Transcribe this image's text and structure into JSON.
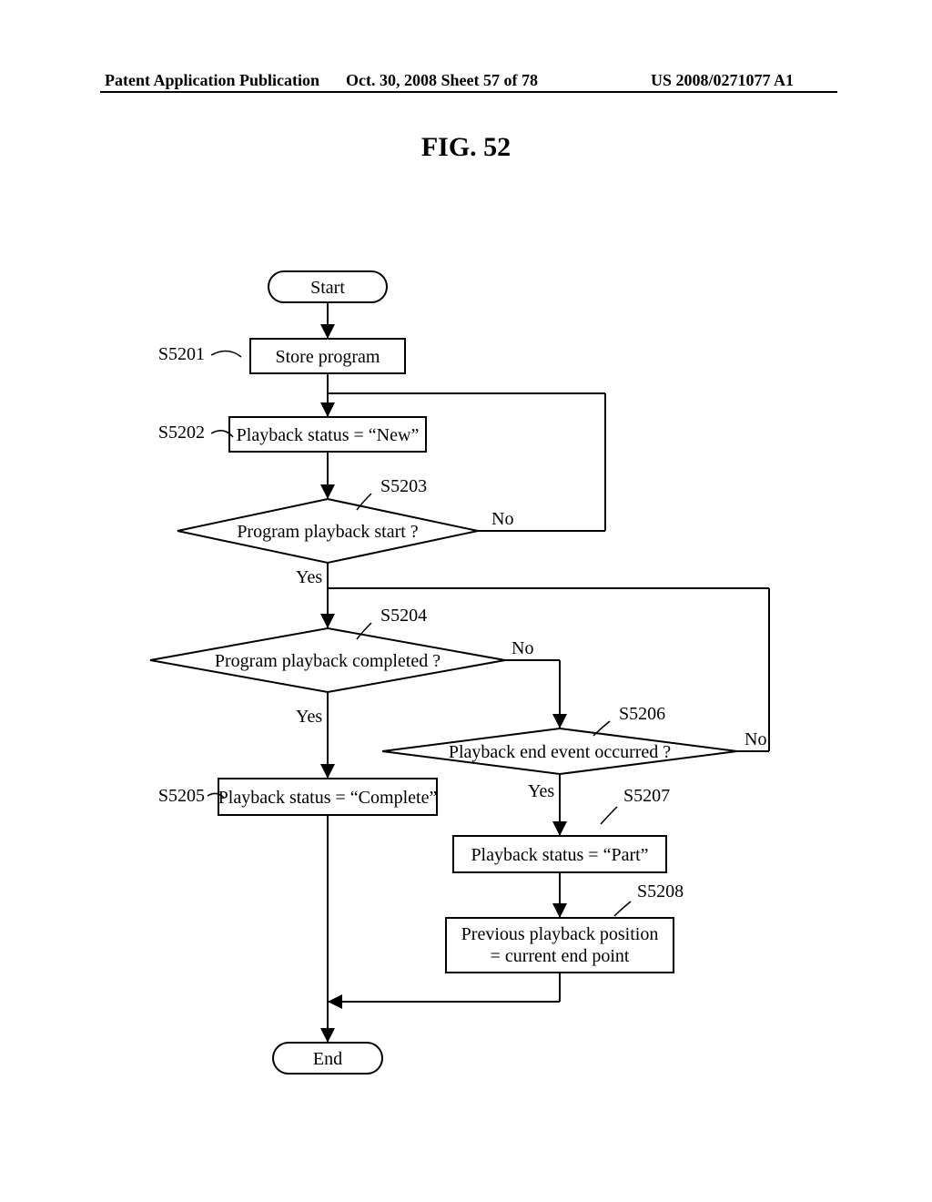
{
  "header": {
    "left": "Patent Application Publication",
    "center": "Oct. 30, 2008  Sheet 57 of 78",
    "right": "US 2008/0271077 A1"
  },
  "figure_title": "FIG. 52",
  "nodes": {
    "start": "Start",
    "s5201": {
      "label": "S5201",
      "text": "Store program"
    },
    "s5202": {
      "label": "S5202",
      "text": "Playback status = “New”"
    },
    "s5203": {
      "label": "S5203",
      "text": "Program playback start ?"
    },
    "s5204": {
      "label": "S5204",
      "text": "Program playback completed ?"
    },
    "s5205": {
      "label": "S5205",
      "text": "Playback status = “Complete”"
    },
    "s5206": {
      "label": "S5206",
      "text": "Playback end event occurred ?"
    },
    "s5207": {
      "label": "S5207",
      "text": "Playback status = “Part”"
    },
    "s5208": {
      "label": "S5208",
      "text1": "Previous playback position",
      "text2": "= current end point"
    },
    "end": "End"
  },
  "branches": {
    "yes": "Yes",
    "no": "No"
  }
}
